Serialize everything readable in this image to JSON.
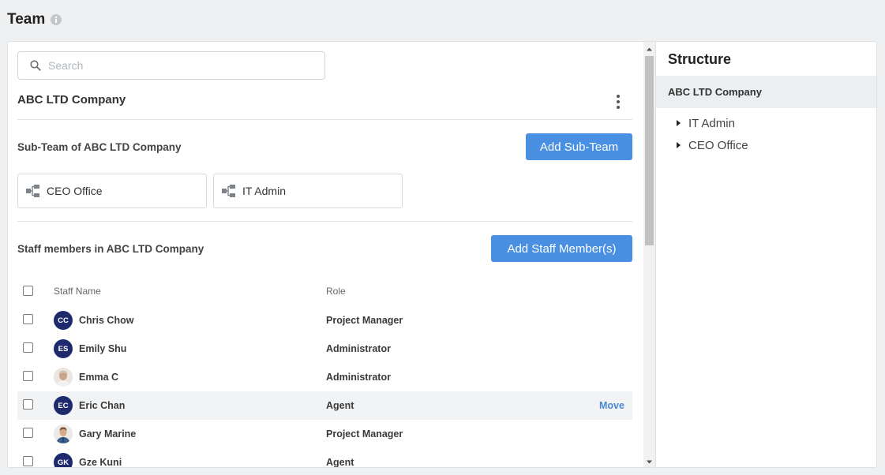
{
  "page": {
    "title": "Team"
  },
  "search": {
    "placeholder": "Search",
    "value": ""
  },
  "company": {
    "name": "ABC LTD Company"
  },
  "subteams": {
    "title": "Sub-Team of ABC LTD Company",
    "add_label": "Add Sub-Team",
    "items": [
      {
        "label": "CEO Office"
      },
      {
        "label": "IT Admin"
      }
    ]
  },
  "staff": {
    "title": "Staff members in ABC LTD Company",
    "add_label": "Add Staff Member(s)",
    "columns": {
      "name": "Staff Name",
      "role": "Role"
    },
    "rows": [
      {
        "initials": "CC",
        "name": "Chris Chow",
        "role": "Project Manager",
        "avatar": "initials"
      },
      {
        "initials": "ES",
        "name": "Emily Shu",
        "role": "Administrator",
        "avatar": "initials"
      },
      {
        "initials": "",
        "name": "Emma C",
        "role": "Administrator",
        "avatar": "photo"
      },
      {
        "initials": "EC",
        "name": "Eric Chan",
        "role": "Agent",
        "avatar": "initials",
        "action": "Move"
      },
      {
        "initials": "",
        "name": "Gary Marine",
        "role": "Project Manager",
        "avatar": "photo"
      },
      {
        "initials": "GK",
        "name": "Gze Kuni",
        "role": "Agent",
        "avatar": "initials"
      }
    ]
  },
  "structure": {
    "title": "Structure",
    "root": "ABC LTD Company",
    "children": [
      {
        "label": "IT Admin"
      },
      {
        "label": "CEO Office"
      }
    ]
  },
  "colors": {
    "accent": "#4a90e2",
    "avatar_bg": "#1d2a6b",
    "link": "#4a86d4"
  },
  "icons": {
    "info": "info-icon",
    "search": "search-icon",
    "more": "more-vertical-icon",
    "team": "org-chart-icon",
    "tree": "caret-right-icon"
  }
}
